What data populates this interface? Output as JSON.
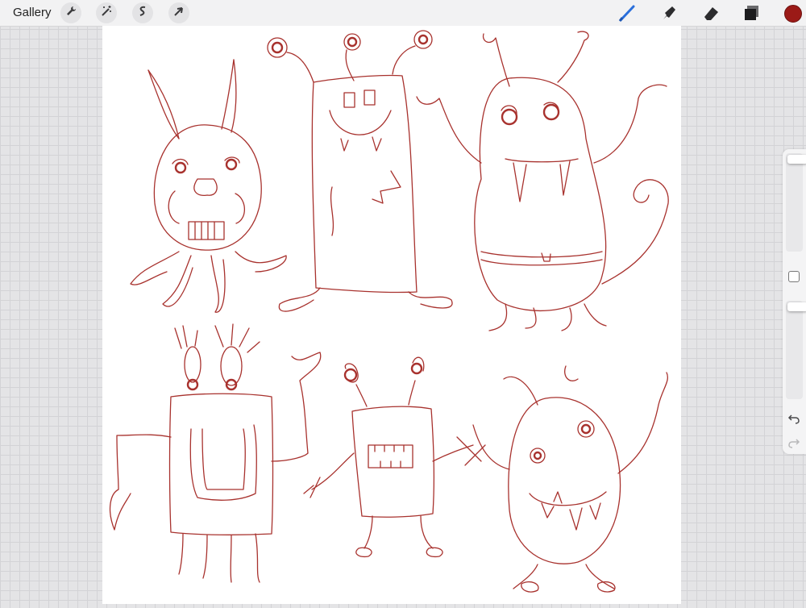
{
  "topbar": {
    "gallery_label": "Gallery",
    "left_tools": [
      "wrench-icon",
      "magic-wand-icon",
      "selection-icon",
      "transform-arrow-icon"
    ],
    "right_tools": [
      "brush-icon",
      "smudge-icon",
      "eraser-icon",
      "layers-icon"
    ],
    "active_tool": "brush",
    "accent_color": "#2a6fdb",
    "current_color": "#9b1a17"
  },
  "sidebar": {
    "brush_size_level": 0.0,
    "opacity_level": 0.0,
    "icons": [
      "modify-button-icon",
      "undo-icon",
      "redo-icon"
    ]
  },
  "canvas": {
    "stroke_color": "#a8322e",
    "background": "#ffffff"
  }
}
